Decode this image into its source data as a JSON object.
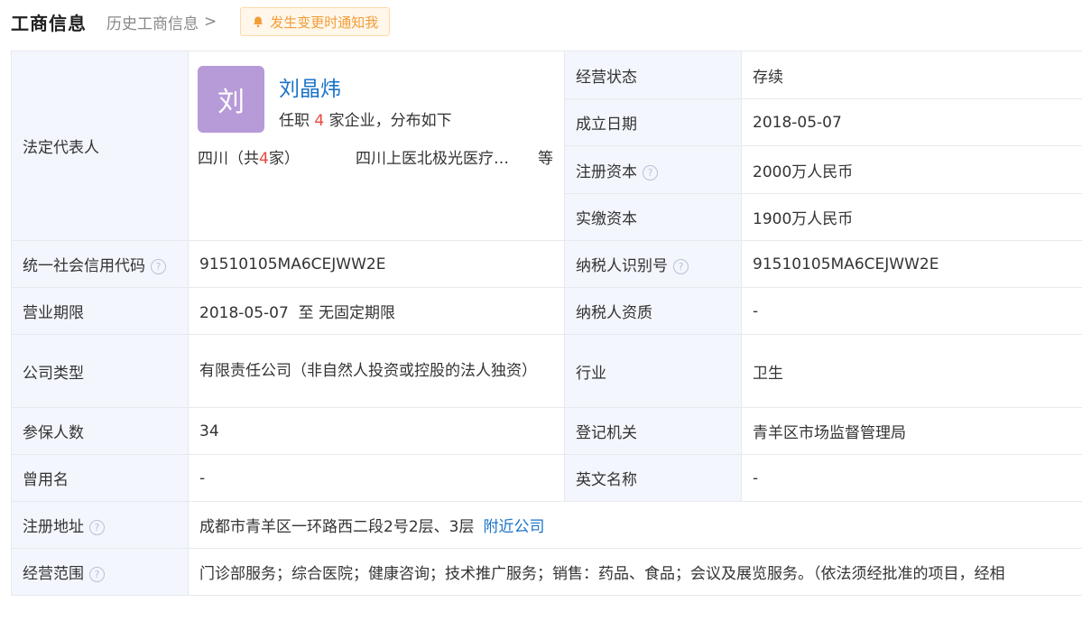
{
  "header": {
    "title": "工商信息",
    "history_link": "历史工商信息",
    "history_chevron": ">",
    "notify_button": "发生变更时通知我"
  },
  "rep": {
    "label": "法定代表人",
    "avatar_char": "刘",
    "name": "刘晶炜",
    "desc_prefix": "任职",
    "count": "4",
    "desc_suffix": "家企业，分布如下",
    "region_prefix": "四川（共",
    "region_count": "4",
    "region_suffix": "家）",
    "company": "四川上医北极光医疗…",
    "etc": "等"
  },
  "right_top": [
    {
      "label": "经营状态",
      "value": "存续"
    },
    {
      "label": "成立日期",
      "value": "2018-05-07"
    },
    {
      "label": "注册资本",
      "value": "2000万人民币"
    },
    {
      "label": "实缴资本",
      "value": "1900万人民币"
    }
  ],
  "credit": {
    "label": "统一社会信用代码",
    "value": "91510105MA6CEJWW2E"
  },
  "taxid": {
    "label": "纳税人识别号",
    "value": "91510105MA6CEJWW2E"
  },
  "term": {
    "label": "营业期限",
    "value": "2018-05-07  至 无固定期限"
  },
  "tax_quality": {
    "label": "纳税人资质",
    "value": "-"
  },
  "company_type": {
    "label": "公司类型",
    "value": "有限责任公司（非自然人投资或控股的法人独资）"
  },
  "industry": {
    "label": "行业",
    "value": "卫生"
  },
  "insured": {
    "label": "参保人数",
    "value": "34"
  },
  "authority": {
    "label": "登记机关",
    "value": "青羊区市场监督管理局"
  },
  "former_name": {
    "label": "曾用名",
    "value": "-"
  },
  "english_name": {
    "label": "英文名称",
    "value": "-"
  },
  "address": {
    "label": "注册地址",
    "value": "成都市青羊区一环路西二段2号2层、3层",
    "link": "附近公司"
  },
  "scope": {
    "label": "经营范围",
    "value": "门诊部服务；综合医院；健康咨询；技术推广服务；销售：药品、食品；会议及展览服务。（依法须经批准的项目，经相"
  },
  "help_icon": "?",
  "colors": {
    "accent": "#1a73c8",
    "label_bg": "#f3f6fc",
    "notify": "#f29d38",
    "count_red": "#e8483f",
    "avatar_bg": "#b79ad8"
  }
}
